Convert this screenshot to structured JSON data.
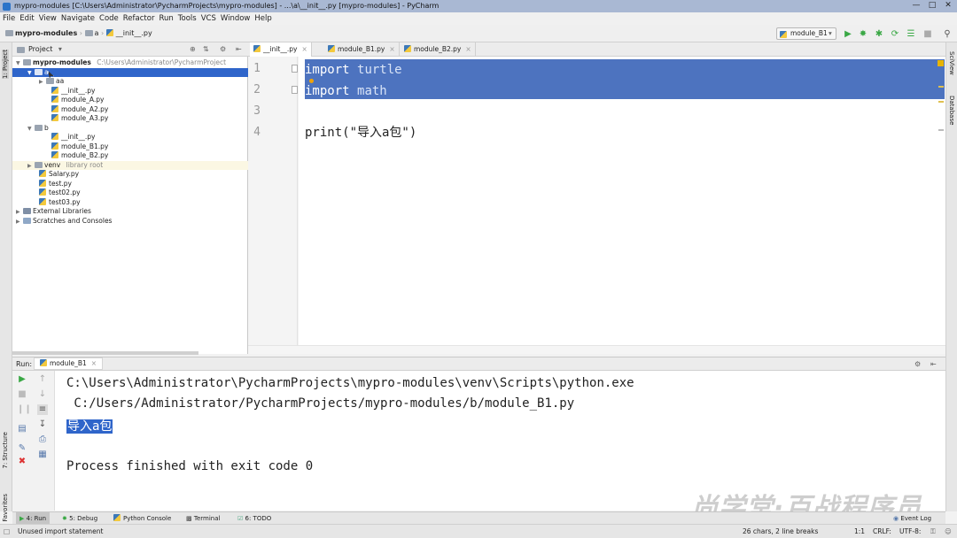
{
  "window": {
    "title": "mypro-modules [C:\\Users\\Administrator\\PycharmProjects\\mypro-modules] - ...\\a\\__init__.py [mypro-modules] - PyCharm"
  },
  "menu": [
    "File",
    "Edit",
    "View",
    "Navigate",
    "Code",
    "Refactor",
    "Run",
    "Tools",
    "VCS",
    "Window",
    "Help"
  ],
  "breadcrumb": {
    "project": "mypro-modules",
    "folder": "a",
    "file": "__init__.py"
  },
  "run_config": "module_B1",
  "project_panel": {
    "header": "Project",
    "root_name": "mypro-modules",
    "root_path": "C:\\Users\\Administrator\\PycharmProject",
    "selected": "a",
    "items": {
      "aa": "aa",
      "a_init": "__init__.py",
      "moduleA": "module_A.py",
      "moduleA2": "module_A2.py",
      "moduleA3": "module_A3.py",
      "b": "b",
      "b_init": "__init__.py",
      "moduleB1": "module_B1.py",
      "moduleB2": "module_B2.py",
      "venv": "venv",
      "venv_note": "library root",
      "salary": "Salary.py",
      "test": "test.py",
      "test02": "test02.py",
      "test03": "test03.py",
      "ext": "External Libraries",
      "scratch": "Scratches and Consoles"
    }
  },
  "editor": {
    "tabs": [
      "__init__.py",
      "module_B1.py",
      "module_B2.py"
    ],
    "line_numbers": [
      "1",
      "2",
      "3",
      "4"
    ],
    "line1": {
      "kw": "import",
      "name": "turtle"
    },
    "line2": {
      "kw": "import",
      "name": "math"
    },
    "line4": "print(\"导入a包\")"
  },
  "run": {
    "label": "Run:",
    "tab": "module_B1",
    "output": {
      "line1": "C:\\Users\\Administrator\\PycharmProjects\\mypro-modules\\venv\\Scripts\\python.exe",
      "line2": " C:/Users/Administrator/PycharmProjects/mypro-modules/b/module_B1.py",
      "line3": "导入a包",
      "line4": "Process finished with exit code 0"
    }
  },
  "watermark": "尚学堂·百战程序员",
  "left_strip": {
    "project": "1: Project",
    "structure": "7: Structure",
    "favorites": "2: Favorites"
  },
  "right_strip": {
    "sciview": "SciView",
    "database": "Database"
  },
  "toolwindows": [
    "4: Run",
    "5: Debug",
    "Python Console",
    "Terminal",
    "6: TODO"
  ],
  "event_log": "Event Log",
  "status": {
    "message": "Unused import statement",
    "chars": "26 chars, 2 line breaks",
    "position": "1:1",
    "line_sep": "CRLF:",
    "encoding": "UTF-8:"
  }
}
